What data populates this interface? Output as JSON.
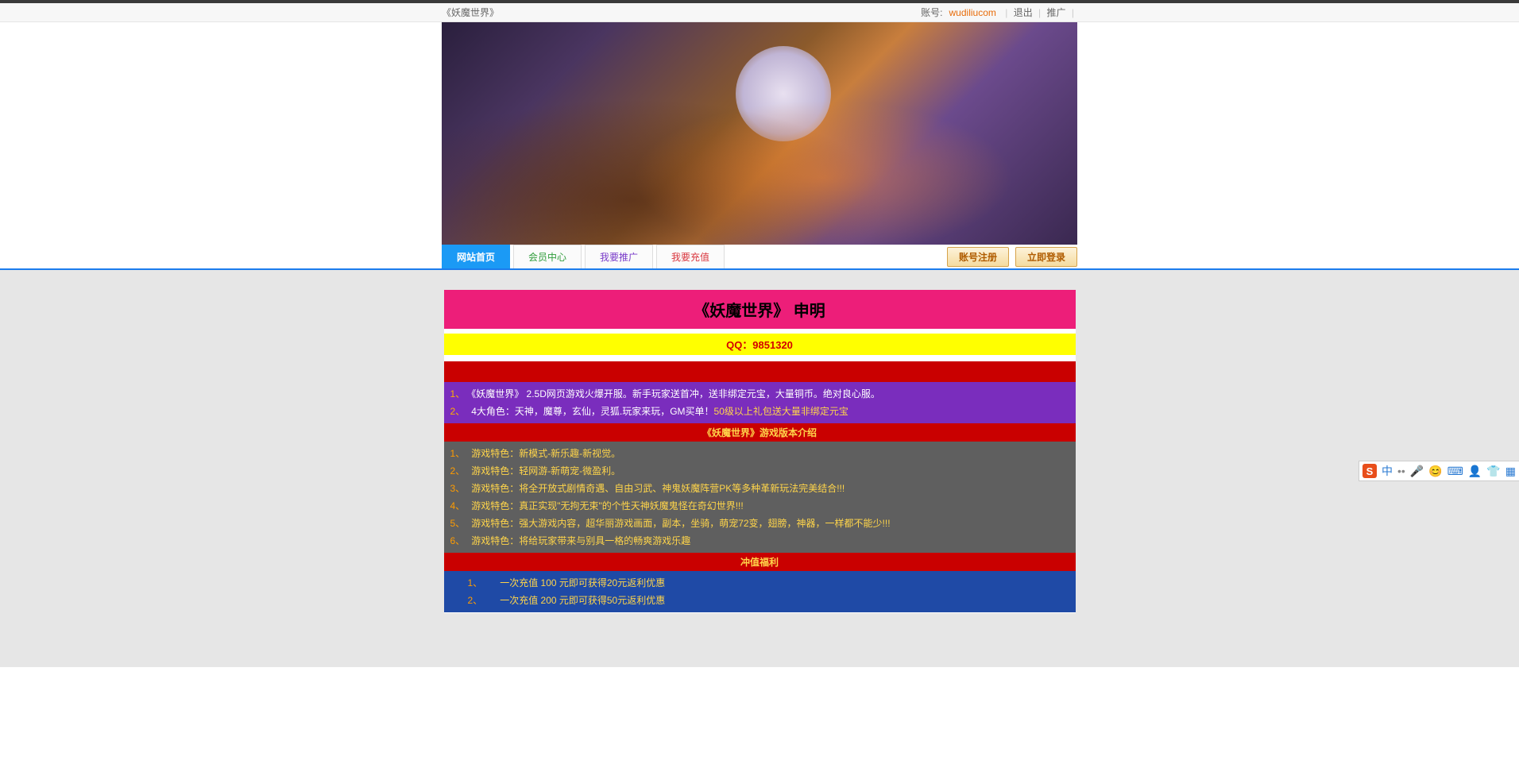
{
  "topbar": {
    "siteTitle": "《妖魔世界》",
    "accountLabel": "账号:",
    "username": "wudiliucom",
    "logout": "退出",
    "promote": "推广"
  },
  "nav": {
    "items": [
      {
        "label": "网站首页"
      },
      {
        "label": "会员中心"
      },
      {
        "label": "我要推广"
      },
      {
        "label": "我要充值"
      }
    ],
    "register": "账号注册",
    "login": "立即登录"
  },
  "main": {
    "title": "《妖魔世界》 申明",
    "qq": "QQ：9851320",
    "purple": {
      "r1_num": "1、",
      "r1": "《妖魔世界》 2.5D网页游戏火爆开服。新手玩家送首冲，送非绑定元宝，大量铜币。绝对良心服。",
      "r2_num": "2、",
      "r2_a": "4大角色：天神，魔尊，玄仙，灵狐.玩家来玩，GM买单！",
      "r2_b": "50级以上礼包送大量非绑定元宝"
    },
    "versionTitle": "《妖魔世界》游戏版本介绍",
    "features": [
      {
        "n": "1、",
        "t": "游戏特色：新模式-新乐趣-新视觉。"
      },
      {
        "n": "2、",
        "t": "游戏特色：轻网游-新萌宠-微盈利。"
      },
      {
        "n": "3、",
        "t": "游戏特色：将全开放式剧情奇遇、自由习武、神鬼妖魔阵营PK等多种革新玩法完美结合!!!"
      },
      {
        "n": "4、",
        "t": "游戏特色：真正实现\"无拘无束\"的个性天神妖魔鬼怪在奇幻世界!!!"
      },
      {
        "n": "5、",
        "t": "游戏特色：强大游戏内容，超华丽游戏画面，副本，坐骑，萌宠72变，翅膀，神器，一样都不能少!!!"
      },
      {
        "n": "6、",
        "t": "游戏特色：将给玩家带来与别具一格的畅爽游戏乐趣"
      }
    ],
    "rechargeTitle": "冲值福利",
    "recharge": [
      {
        "n": "1、",
        "t": "一次充值 100 元即可获得20元返利优惠"
      },
      {
        "n": "2、",
        "t": "一次充值 200 元即可获得50元返利优惠"
      }
    ]
  },
  "ime": {
    "s": "S",
    "zh": "中"
  }
}
